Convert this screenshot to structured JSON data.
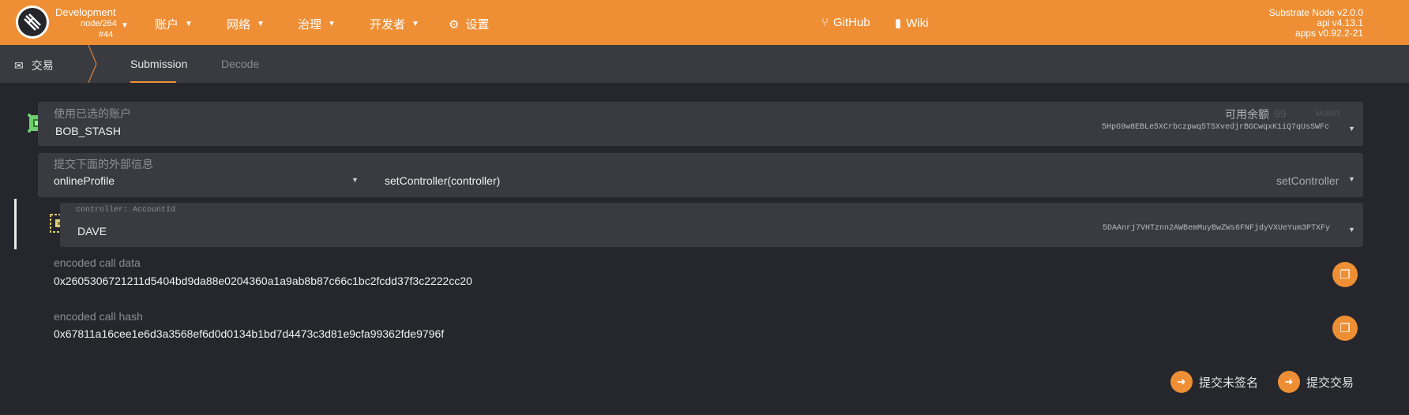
{
  "header": {
    "chain_name": "Development",
    "node_info": "node/264",
    "block": "#44",
    "nav": [
      {
        "label": "账户"
      },
      {
        "label": "网络"
      },
      {
        "label": "治理"
      },
      {
        "label": "开发者"
      },
      {
        "label": "设置"
      }
    ],
    "github_label": "GitHub",
    "wiki_label": "Wiki",
    "version_node": "Substrate Node v2.0.0",
    "version_api": "api v4.13.1",
    "version_apps": "apps v0.92.2-21",
    "accent": "#ef8f35"
  },
  "tabs": {
    "root_label": "交易",
    "items": [
      {
        "label": "Submission"
      },
      {
        "label": "Decode"
      }
    ]
  },
  "account": {
    "label": "使用已选的账户",
    "name": "BOB_STASH",
    "balance_label": "可用余额",
    "balance_value": "99",
    "balance_unit": "MUNIT",
    "address": "5HpG9w8EBLe5XCrbczpwq5TSXvedjrBGCwqxK1iQ7qUsSWFc"
  },
  "extrinsic": {
    "label": "提交下面的外部信息",
    "module": "onlineProfile",
    "method": "setController(controller)",
    "method_short": "setController"
  },
  "param": {
    "label": "controller: AccountId",
    "name": "DAVE",
    "address": "5DAAnrj7VHTznn2AWBemMuyBwZWs6FNFjdyVXUeYum3PTXFy"
  },
  "encoded": {
    "call_data_label": "encoded call data",
    "call_data": "0x2605306721211d5404bd9da88e0204360a1a9ab8b87c66c1bc2fcdd37f3c2222cc20",
    "call_hash_label": "encoded call hash",
    "call_hash": "0x67811a16cee1e6d3a3568ef6d0d0134b1bd7d4473c3d81e9cfa99362fde9796f"
  },
  "actions": {
    "unsigned_label": "提交未签名",
    "submit_label": "提交交易"
  }
}
